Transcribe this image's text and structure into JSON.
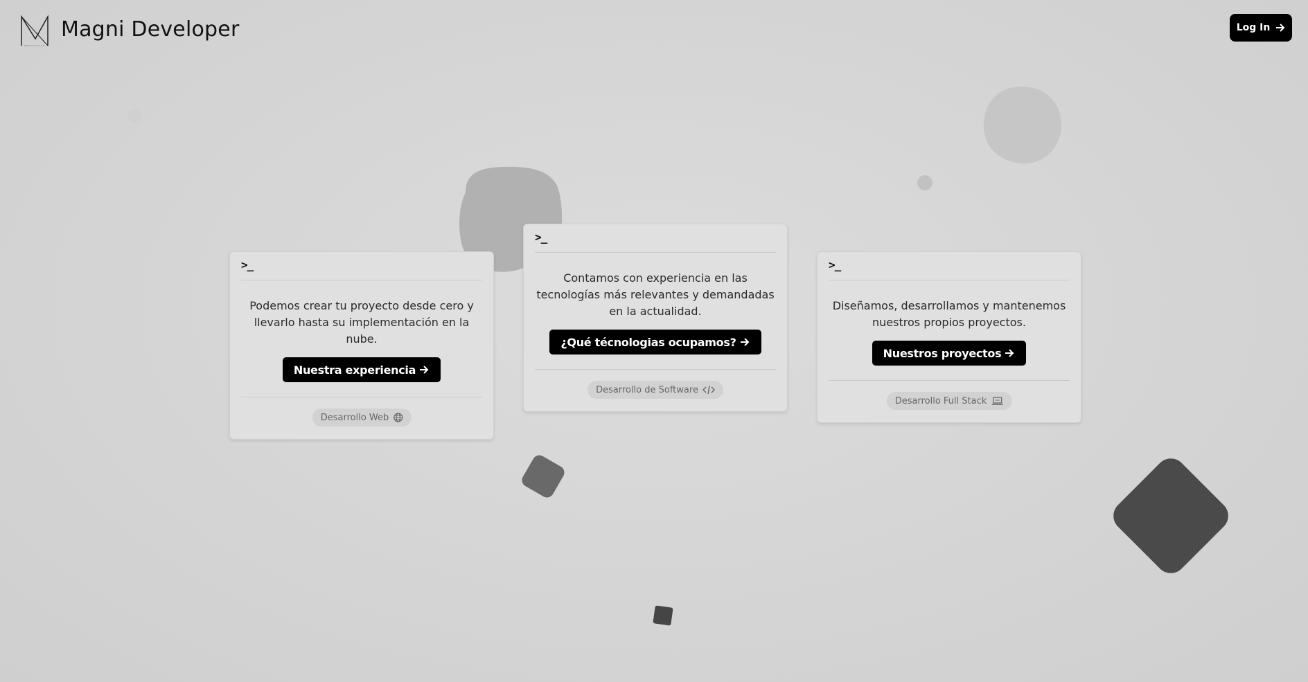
{
  "header": {
    "brand": "Magni Developer",
    "login_label": "Log In"
  },
  "cards": [
    {
      "text": "Podemos crear tu proyecto desde cero y llevarlo hasta su implementación en la nube.",
      "button": "Nuestra experiencia",
      "tag": "Desarrollo Web",
      "tag_icon": "globe-icon"
    },
    {
      "text": "Contamos con experiencia en las tecnologías más relevantes y demandadas en la actualidad.",
      "button": "¿Qué técnologias ocupamos?",
      "tag": "Desarrollo de Software",
      "tag_icon": "code-icon"
    },
    {
      "text": "Diseñamos, desarrollamos y mantenemos nuestros propios proyectos.",
      "button": "Nuestros proyectos",
      "tag": "Desarrollo Full Stack",
      "tag_icon": "laptop-icon"
    }
  ],
  "prompt_symbol": ">_",
  "colors": {
    "background": "#d6d6d6",
    "card": "#e0e0e0",
    "button": "#000000",
    "accent_dark": "#4a4a4a"
  }
}
